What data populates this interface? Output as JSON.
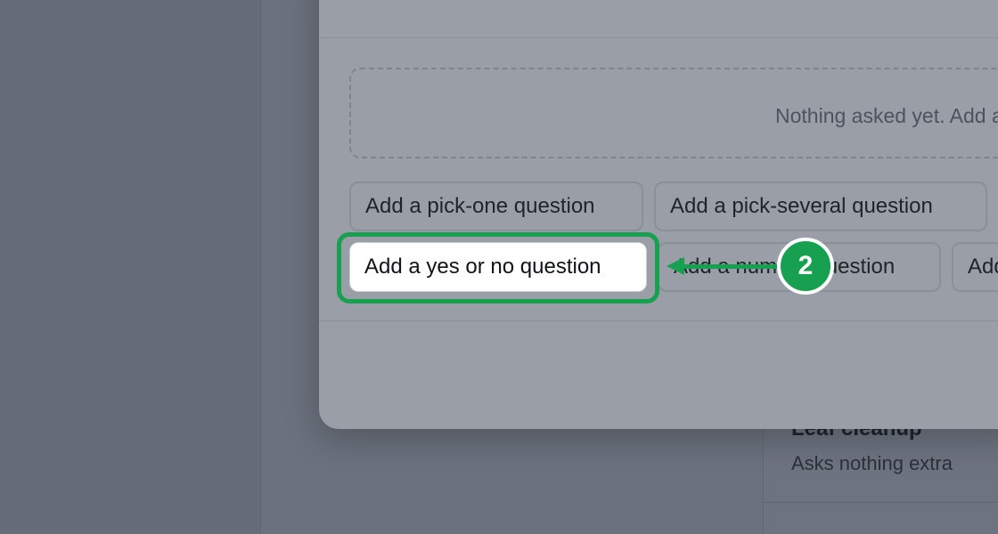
{
  "background": {
    "card_title": "Leaf cleanup",
    "card_subtitle": "Asks nothing extra"
  },
  "modal": {
    "empty_state": "Nothing asked yet. Add a question below."
  },
  "buttons": {
    "pick_one": "Add a pick-one question",
    "pick_several": "Add a pick-several question",
    "yes_no": "Add a yes or no question",
    "number": "Add a number question",
    "more": "Add a text question"
  },
  "annotation": {
    "step_number": "2",
    "accent": "#17a04f"
  }
}
